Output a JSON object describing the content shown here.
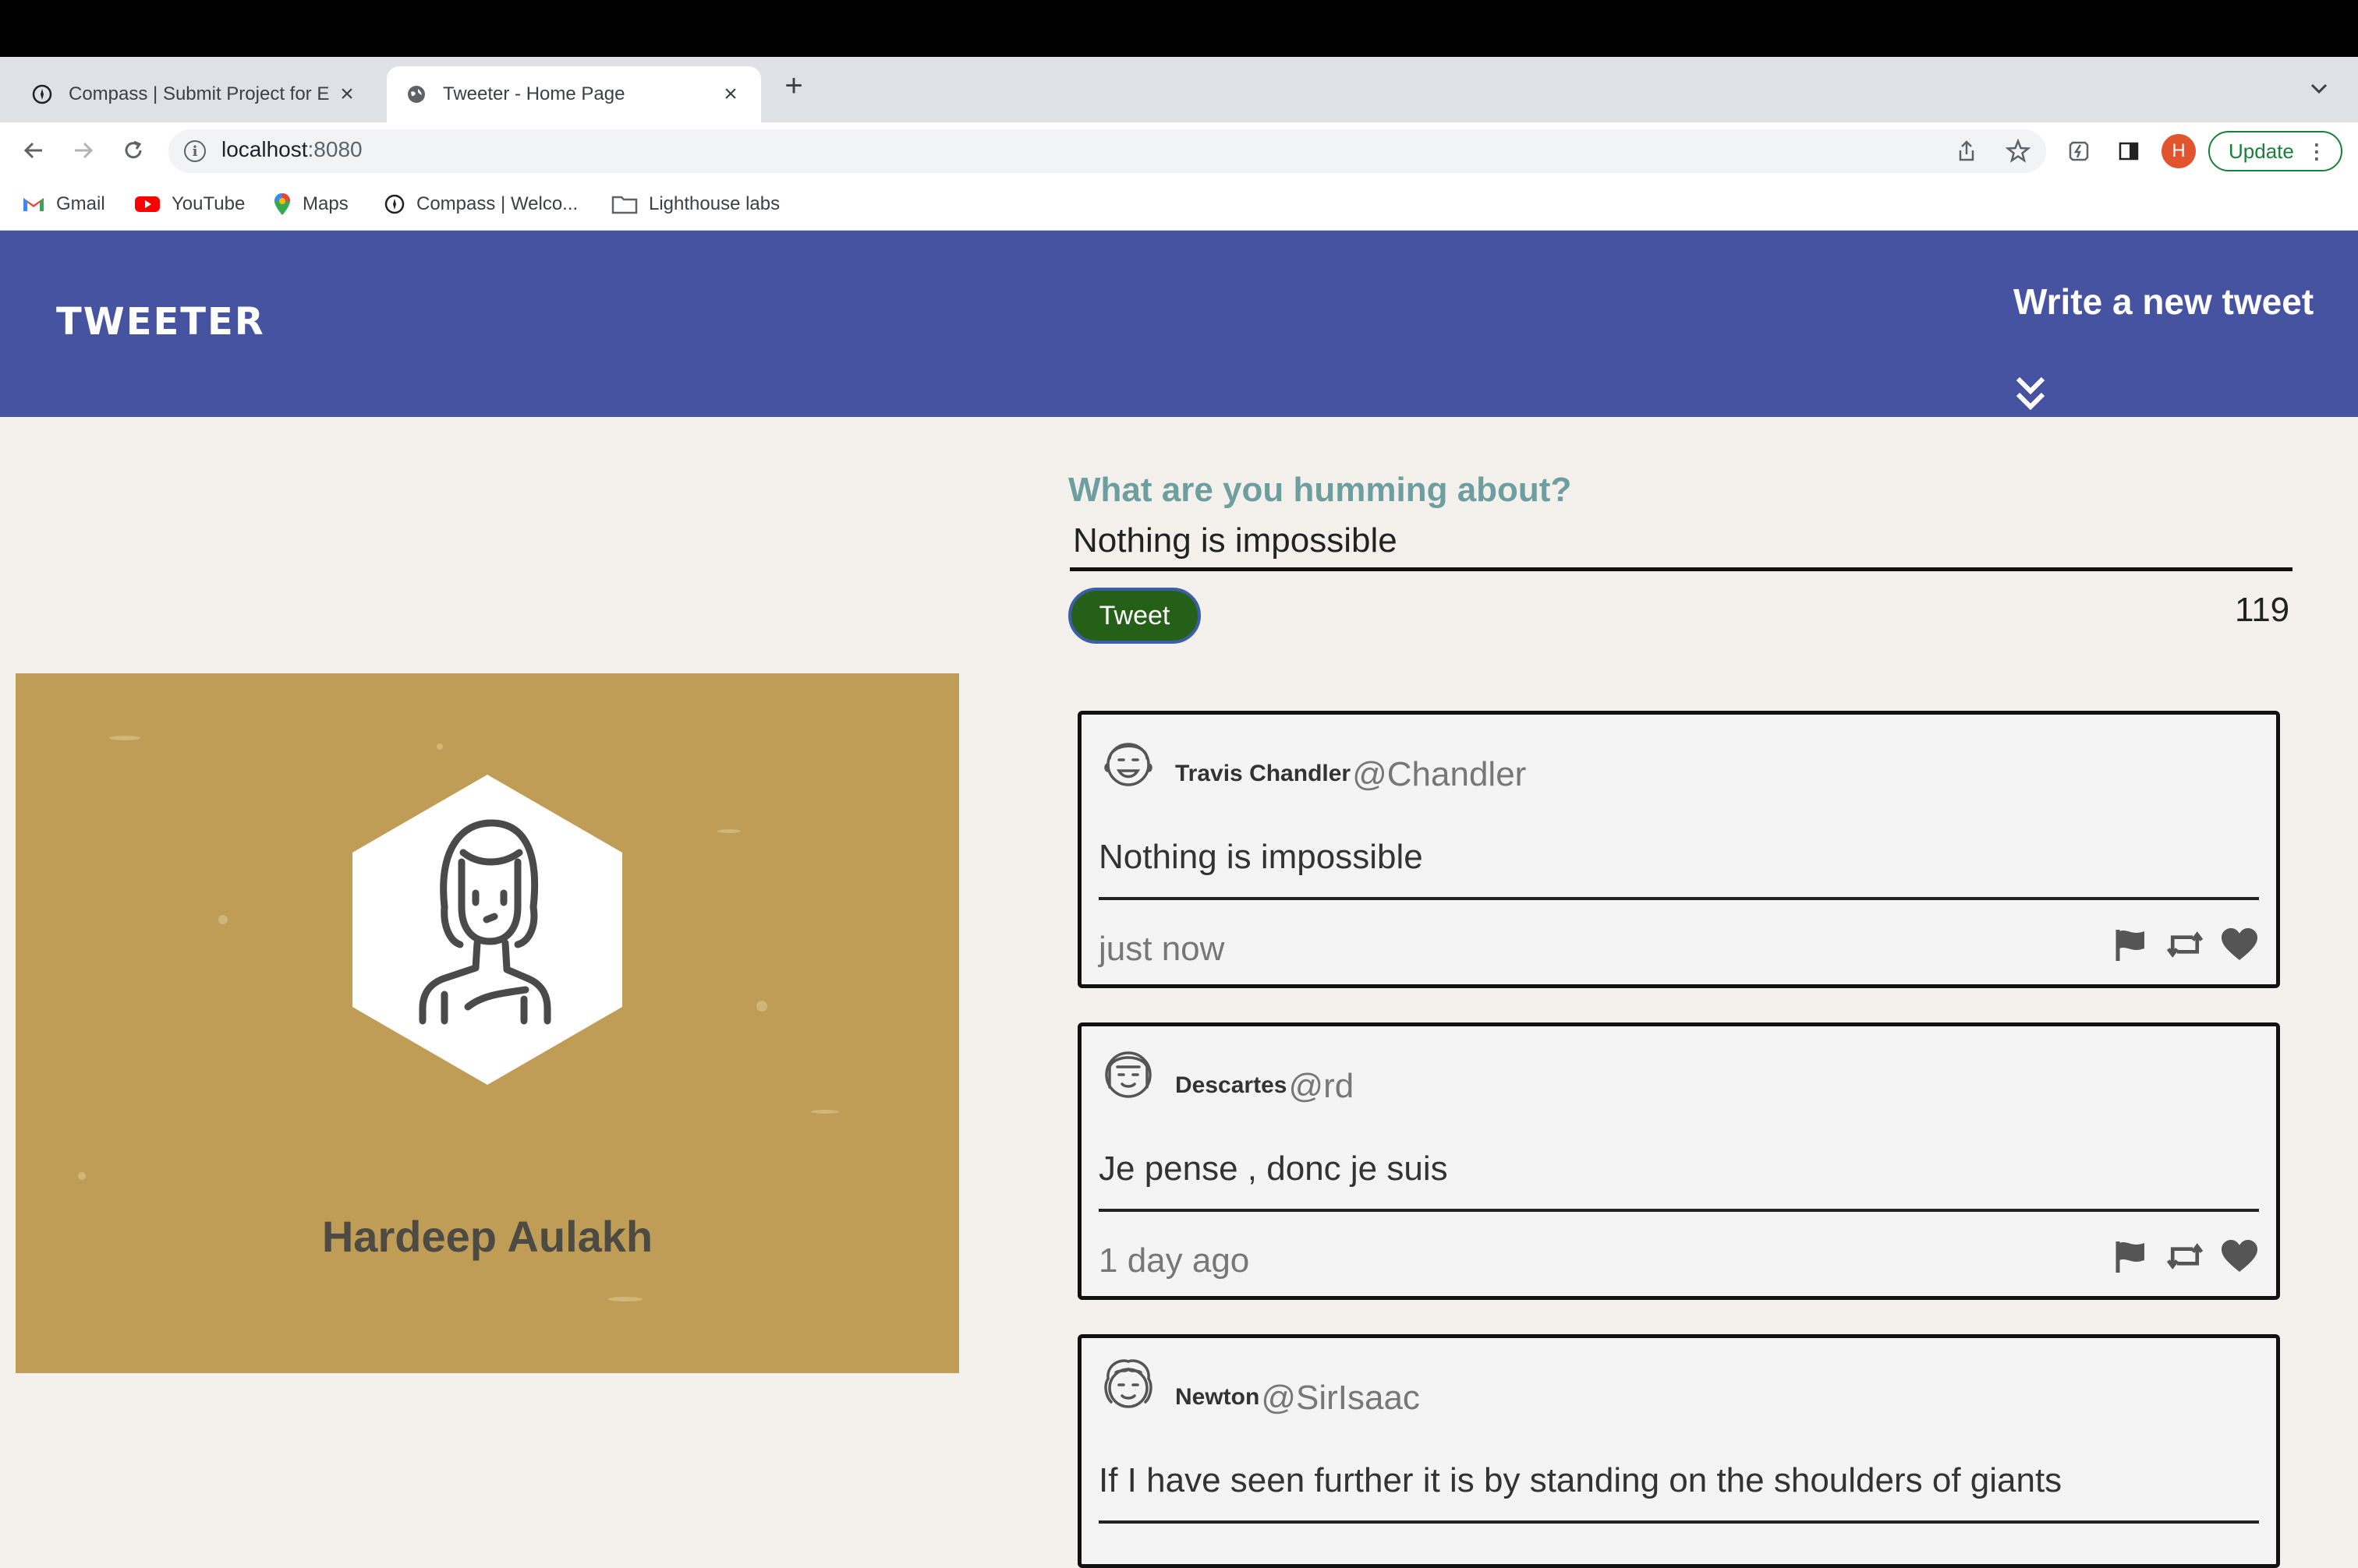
{
  "browser": {
    "tabs": [
      {
        "title": "Compass | Submit Project for E",
        "active": false
      },
      {
        "title": "Tweeter - Home Page",
        "active": true
      }
    ],
    "url_host": "localhost",
    "url_port": ":8080",
    "avatar_letter": "H",
    "update_label": "Update",
    "bookmarks": [
      {
        "label": "Gmail",
        "icon": "gmail-icon"
      },
      {
        "label": "YouTube",
        "icon": "youtube-icon"
      },
      {
        "label": "Maps",
        "icon": "maps-icon"
      },
      {
        "label": "Compass | Welco...",
        "icon": "compass-icon"
      },
      {
        "label": "Lighthouse labs",
        "icon": "folder-icon"
      }
    ]
  },
  "app": {
    "logo": "TWEETER",
    "write_link": "Write a new tweet",
    "header_color": "#4653a0"
  },
  "compose": {
    "question": "What are you humming about?",
    "value": "Nothing is impossible",
    "button_label": "Tweet",
    "counter": "119"
  },
  "profile": {
    "name": "Hardeep Aulakh"
  },
  "tweets": [
    {
      "name": "Travis Chandler",
      "handle": "@Chandler",
      "text": "Nothing is impossible",
      "time": "just now"
    },
    {
      "name": "Descartes",
      "handle": "@rd",
      "text": "Je pense , donc je suis",
      "time": "1 day ago"
    },
    {
      "name": "Newton",
      "handle": "@SirIsaac",
      "text": "If I have seen further it is by standing on the shoulders of giants",
      "time": ""
    }
  ]
}
